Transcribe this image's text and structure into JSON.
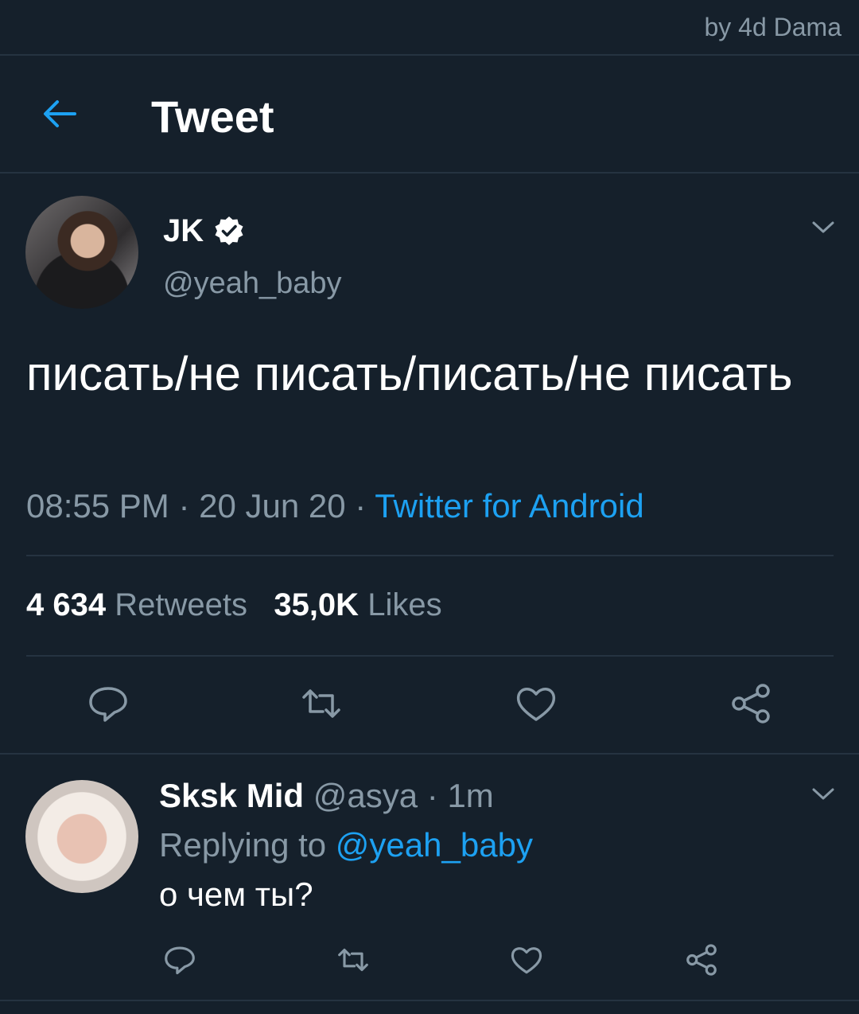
{
  "watermark": "by 4d Dama",
  "header": {
    "title": "Tweet"
  },
  "tweet": {
    "author_name": "JK",
    "author_handle": "@yeah_baby",
    "text": "писать/не писать/писать/не писать",
    "time": "08:55 PM",
    "date": "20 Jun 20",
    "separator": "·",
    "source": "Twitter for Android",
    "retweets_count": "4 634",
    "retweets_label": "Retweets",
    "likes_count": "35,0K",
    "likes_label": "Likes"
  },
  "reply": {
    "author_name": "Sksk Mid",
    "author_handle": "@asya",
    "time": "1m",
    "replying_prefix": "Replying to",
    "replying_handle": "@yeah_baby",
    "text": "о чем ты?"
  },
  "colors": {
    "background": "#15202b",
    "accent": "#1da1f2",
    "muted": "#8899a6",
    "divider": "#253341"
  },
  "icons": [
    "back-arrow-icon",
    "verified-icon",
    "chevron-down-icon",
    "reply-icon",
    "retweet-icon",
    "like-icon",
    "share-icon"
  ]
}
